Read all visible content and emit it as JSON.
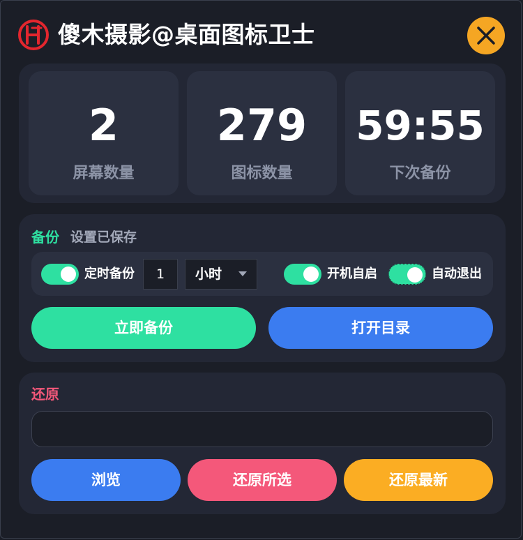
{
  "app": {
    "title": "傻木摄影@桌面图标卫士",
    "logo_icon": "logo-badge-icon",
    "close_icon": "close-icon"
  },
  "colors": {
    "background": "#1b1e27",
    "panel": "#232735",
    "card": "#2b3040",
    "green": "#2ee0a1",
    "blue": "#3b7cf0",
    "pink": "#f4587a",
    "orange": "#fbad23",
    "logo_red": "#e3262e"
  },
  "stats": [
    {
      "value": "2",
      "label": "屏幕数量"
    },
    {
      "value": "279",
      "label": "图标数量"
    },
    {
      "value": "59:55",
      "label": "下次备份"
    }
  ],
  "backup": {
    "title": "备份",
    "status": "设置已保存",
    "scheduled": {
      "label": "定时备份",
      "on": true
    },
    "interval_value": "1",
    "interval_unit": "小时",
    "autostart": {
      "label": "开机自启",
      "on": true
    },
    "autoexit": {
      "label": "自动退出",
      "on": true
    },
    "backup_now_label": "立即备份",
    "open_dir_label": "打开目录"
  },
  "restore": {
    "title": "还原",
    "path_value": "",
    "path_placeholder": "",
    "browse_label": "浏览",
    "restore_selected_label": "还原所选",
    "restore_latest_label": "还原最新"
  }
}
